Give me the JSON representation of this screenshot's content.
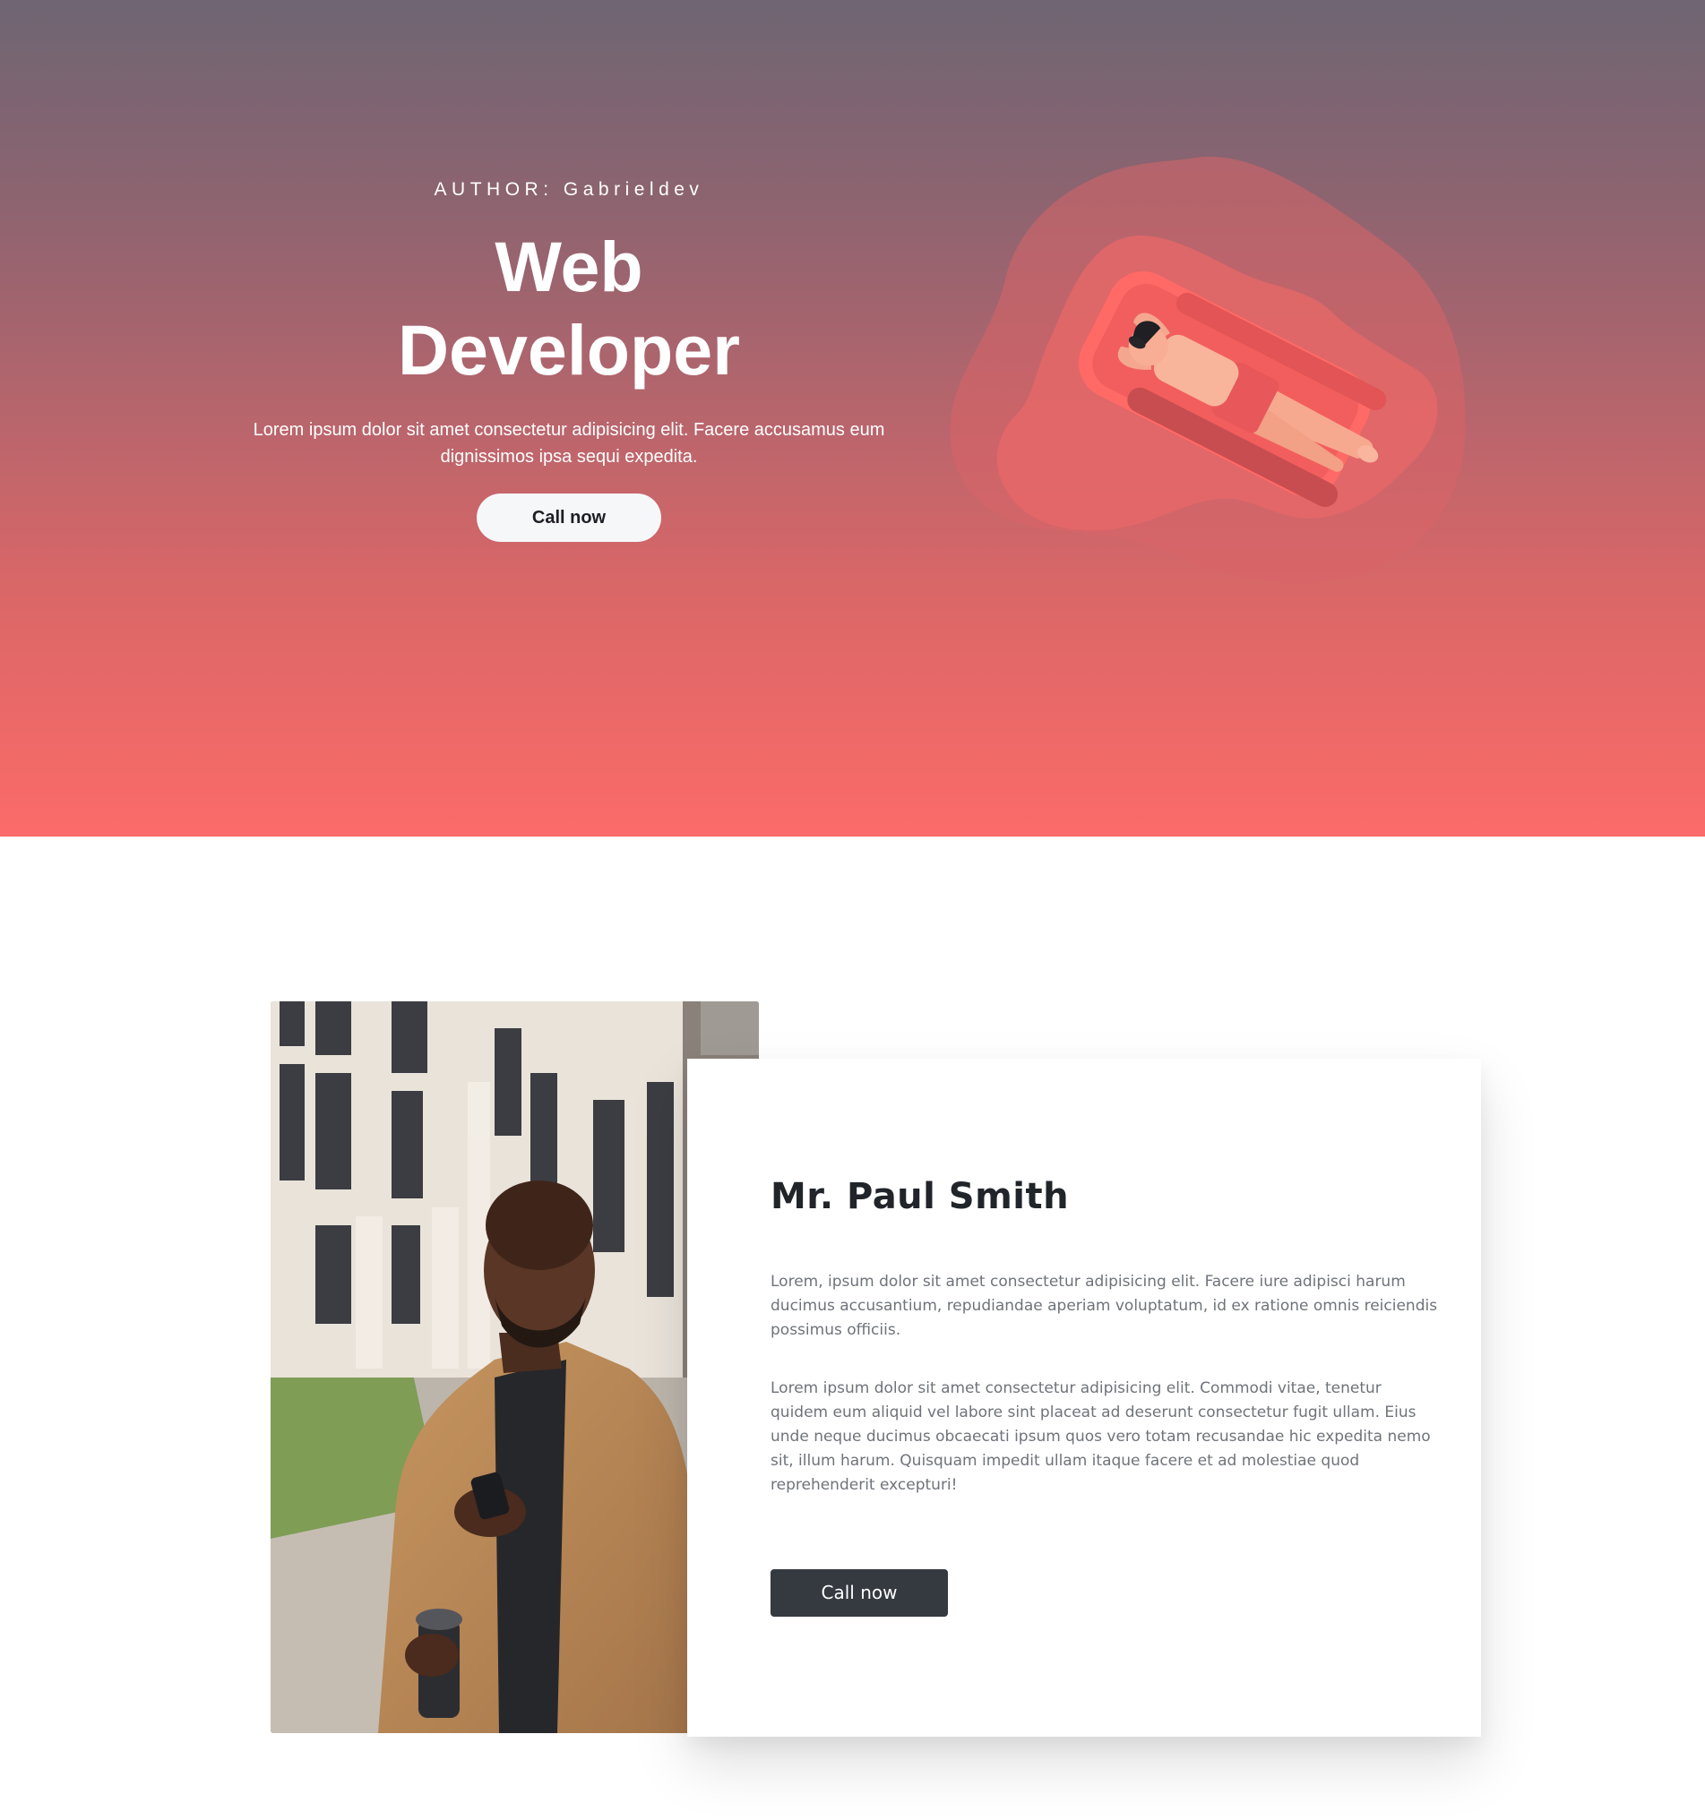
{
  "hero": {
    "author": "AUTHOR: Gabrieldev",
    "title_line1": "Web",
    "title_line2": "Developer",
    "description": "Lorem ipsum dolor sit amet consectetur adipisicing elit. Facere accusamus eum dignissimos ipsa sequi expedita.",
    "button_label": "Call now"
  },
  "profile": {
    "name": "Mr. Paul Smith",
    "paragraph1": "Lorem, ipsum dolor sit amet consectetur adipisicing elit. Facere iure adipisci harum ducimus accusantium, repudiandae aperiam voluptatum, id ex ratione omnis reiciendis possimus officiis.",
    "paragraph2": "Lorem ipsum dolor sit amet consectetur adipisicing elit. Commodi vitae, tenetur quidem eum aliquid vel labore sint placeat ad deserunt consectetur fugit ullam. Eius unde neque ducimus obcaecati ipsum quos vero totam recusandae hic expedita nemo sit, illum harum. Quisquam impedit ullam itaque facere et ad molestiae quod reprehenderit excepturi!",
    "button_label": "Call now"
  },
  "colors": {
    "hero_gradient_top": "#6f6573",
    "hero_gradient_bottom": "#fb6b69",
    "card_button": "#343a40"
  }
}
